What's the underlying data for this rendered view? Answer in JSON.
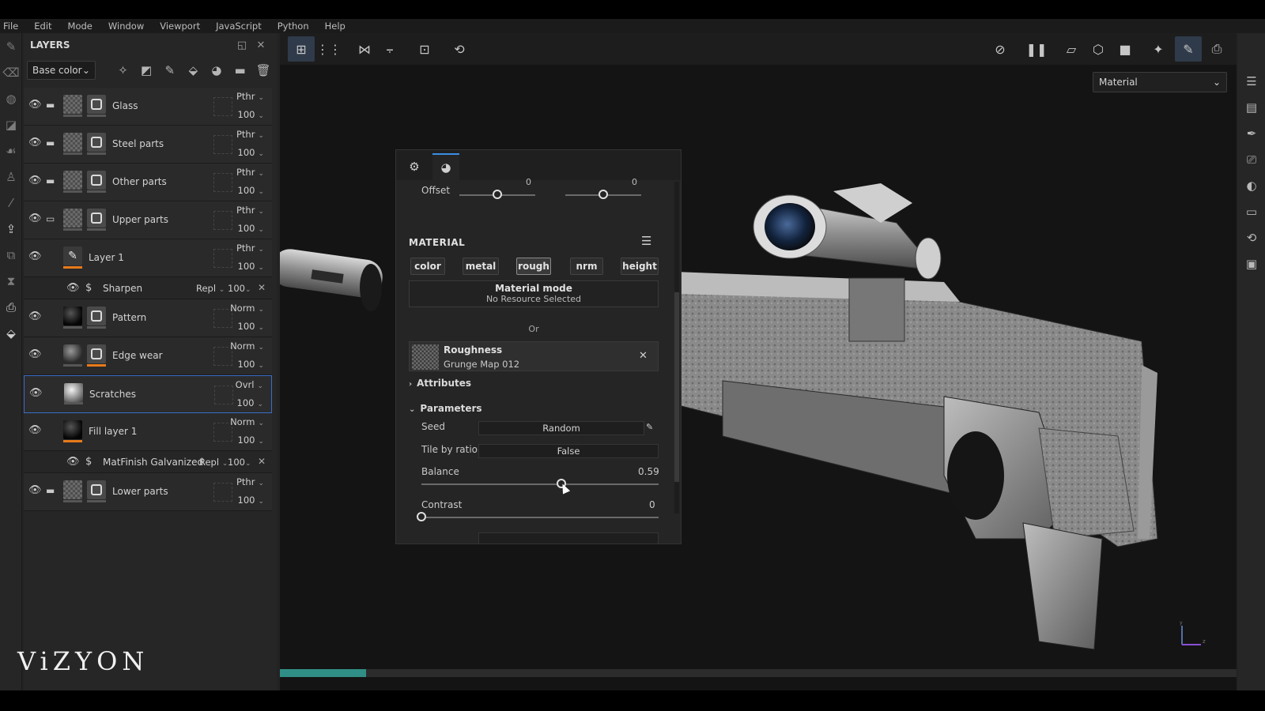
{
  "menu": [
    "File",
    "Edit",
    "Mode",
    "Window",
    "Viewport",
    "JavaScript",
    "Python",
    "Help"
  ],
  "layers_panel": {
    "title": "LAYERS",
    "channel_select": "Base color",
    "layers": [
      {
        "name": "Glass",
        "blend": "Pthr",
        "opacity": "100",
        "type": "folder",
        "thumb": "checker"
      },
      {
        "name": "Steel parts",
        "blend": "Pthr",
        "opacity": "100",
        "type": "folder",
        "thumb": "checker"
      },
      {
        "name": "Other parts",
        "blend": "Pthr",
        "opacity": "100",
        "type": "folder",
        "thumb": "checker"
      },
      {
        "name": "Upper parts",
        "blend": "Pthr",
        "opacity": "100",
        "type": "folder-open",
        "thumb": "checker"
      },
      {
        "name": "Layer 1",
        "blend": "Pthr",
        "opacity": "100",
        "type": "paint",
        "thumb": "brush"
      },
      {
        "name": "Sharpen",
        "blend": "Repl",
        "opacity": "100",
        "type": "filter"
      },
      {
        "name": "Pattern",
        "blend": "Norm",
        "opacity": "100",
        "type": "fill",
        "thumb": "black"
      },
      {
        "name": "Edge wear",
        "blend": "Norm",
        "opacity": "100",
        "type": "fill",
        "thumb": "dkgrey"
      },
      {
        "name": "Scratches",
        "blend": "Ovrl",
        "opacity": "100",
        "type": "fill",
        "thumb": "sphere",
        "selected": true
      },
      {
        "name": "Fill layer 1",
        "blend": "Norm",
        "opacity": "100",
        "type": "fill",
        "thumb": "black"
      },
      {
        "name": "MatFinish Galvanized",
        "blend": "Repl",
        "opacity": "100",
        "type": "filter"
      },
      {
        "name": "Lower parts",
        "blend": "Pthr",
        "opacity": "100",
        "type": "folder",
        "thumb": "checker"
      }
    ]
  },
  "viewport": {
    "display_mode": "Material",
    "progress": 0.09
  },
  "properties": {
    "offset_label": "Offset",
    "offset_values": [
      "0",
      "0"
    ],
    "material_title": "MATERIAL",
    "channels": [
      "color",
      "metal",
      "rough",
      "nrm",
      "height"
    ],
    "active_channel": "rough",
    "material_mode_title": "Material mode",
    "material_mode_value": "No Resource Selected",
    "or_label": "Or",
    "resource_name": "Roughness",
    "resource_source": "Grunge Map 012",
    "attributes_label": "Attributes",
    "parameters_label": "Parameters",
    "seed_label": "Seed",
    "seed_value": "Random",
    "tile_label": "Tile by ratio",
    "tile_value": "False",
    "balance_label": "Balance",
    "balance_value": "0.59",
    "contrast_label": "Contrast",
    "contrast_value": "0"
  },
  "watermark": "ViZYON"
}
